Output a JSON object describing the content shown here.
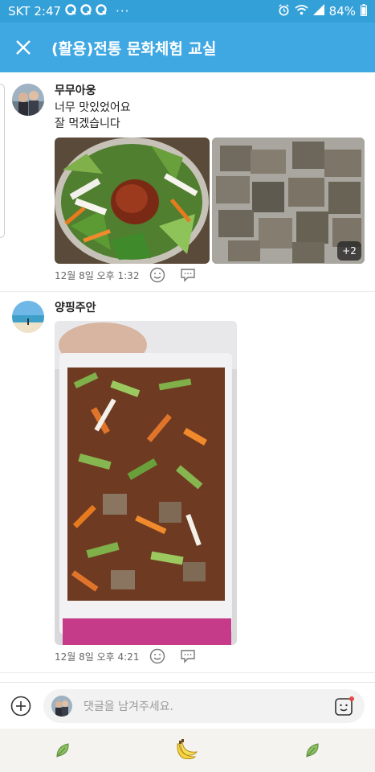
{
  "status_bar": {
    "carrier": "SKT",
    "time": "2:47",
    "notification_icons": [
      "q-icon",
      "q-icon",
      "q-icon"
    ],
    "more": "···",
    "battery": "84%",
    "icons": [
      "alarm-icon",
      "wifi-icon",
      "signal-icon",
      "battery-icon"
    ]
  },
  "app_bar": {
    "title": "(활용)전통 문화체험 교실",
    "close_icon": "close-icon",
    "background": "#3fa8e3"
  },
  "comments": [
    {
      "author": "무무아웅",
      "lines": [
        "너무 맛있었어요",
        "잘 먹겠습니다"
      ],
      "timestamp": "12월 8일 오후 1:32",
      "more_photos": "+2",
      "photos": [
        "salad-photo",
        "jelly-photo"
      ]
    },
    {
      "author": "양핑주안",
      "lines": [],
      "timestamp": "12월 8일 오후 4:21",
      "photos": [
        "mixed-salad-photo"
      ]
    }
  ],
  "input": {
    "placeholder": "댓글을 남겨주세요."
  },
  "bottom_nav": {
    "items": [
      "leaf-icon",
      "banana-icon",
      "leaf-icon"
    ]
  }
}
